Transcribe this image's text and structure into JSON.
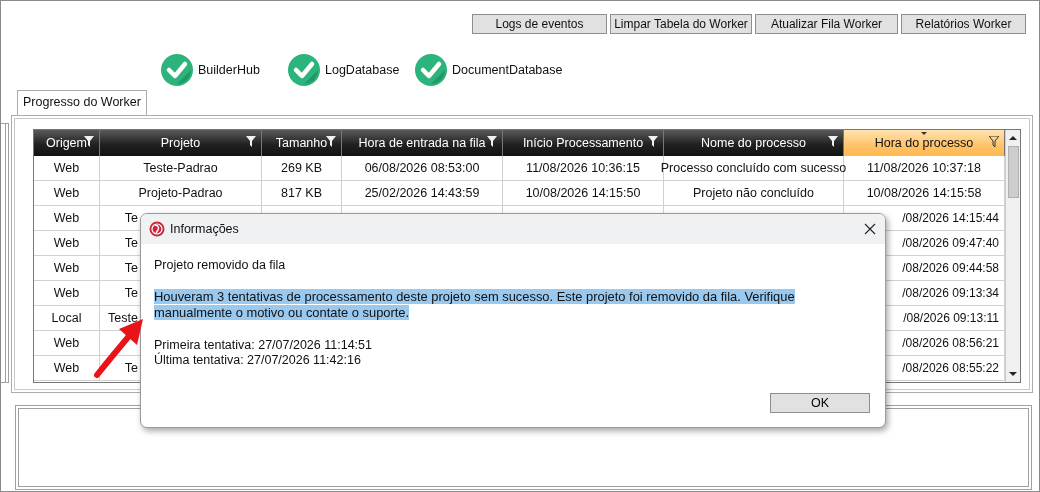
{
  "toolbar": {
    "buttons": [
      "Logs de eventos",
      "Limpar Tabela do Worker",
      "Atualizar Fila Worker",
      "Relatórios Worker"
    ]
  },
  "services": [
    {
      "name": "BuilderHub",
      "ok": true
    },
    {
      "name": "LogDatabase",
      "ok": true
    },
    {
      "name": "DocumentDatabase",
      "ok": true
    }
  ],
  "tabs": [
    {
      "label": "Progresso do Worker",
      "selected": true
    }
  ],
  "table": {
    "columns": [
      {
        "label": "Origem",
        "sorted": false
      },
      {
        "label": "Projeto",
        "sorted": false
      },
      {
        "label": "Tamanho",
        "sorted": false
      },
      {
        "label": "Hora de entrada na fila",
        "sorted": false
      },
      {
        "label": "Início Processamento",
        "sorted": false
      },
      {
        "label": "Nome do processo",
        "sorted": false
      },
      {
        "label": "Hora do processo",
        "sorted": true
      }
    ],
    "rows": [
      {
        "cells": [
          "Web",
          "Teste-Padrao",
          "269 KB",
          "06/08/2026 08:53:00",
          "11/08/2026 10:36:15",
          "Processo concluído com sucesso",
          "11/08/2026 10:37:18"
        ]
      },
      {
        "cells": [
          "Web",
          "Projeto-Padrao",
          "817 KB",
          "25/02/2026 14:43:59",
          "10/08/2026 14:15:50",
          "Projeto não concluído",
          "10/08/2026 14:15:58"
        ]
      },
      {
        "cells": [
          "Web",
          "Te",
          null,
          null,
          null,
          null,
          "/08/2026 14:15:44"
        ]
      },
      {
        "cells": [
          "Web",
          "Te",
          null,
          null,
          null,
          null,
          "/08/2026 09:47:40"
        ]
      },
      {
        "cells": [
          "Web",
          "Te",
          null,
          null,
          null,
          null,
          "/08/2026 09:44:58"
        ]
      },
      {
        "cells": [
          "Web",
          "Te",
          null,
          null,
          null,
          null,
          "/08/2026 09:13:34"
        ]
      },
      {
        "cells": [
          "Local",
          "Teste",
          null,
          null,
          null,
          null,
          "/08/2026 09:13:11"
        ]
      },
      {
        "cells": [
          "Web",
          null,
          null,
          null,
          null,
          null,
          "/08/2026 08:56:21"
        ]
      },
      {
        "cells": [
          "Web",
          "Te",
          null,
          null,
          null,
          null,
          "/08/2026 08:55:22"
        ]
      }
    ]
  },
  "dialog": {
    "title": "Informações",
    "heading": "Projeto removido da fila",
    "message": {
      "text": "Houveram 3 tentativas de processamento deste projeto sem sucesso. Este projeto foi removido da fila. Verifique manualmente o motivo ou contate o suporte.",
      "highlighted": true
    },
    "details": [
      "Primeira tentativa: 27/07/2026 11:14:51",
      "Última tentativa: 27/07/2026 11:42:16"
    ],
    "buttons": [
      "OK"
    ]
  }
}
